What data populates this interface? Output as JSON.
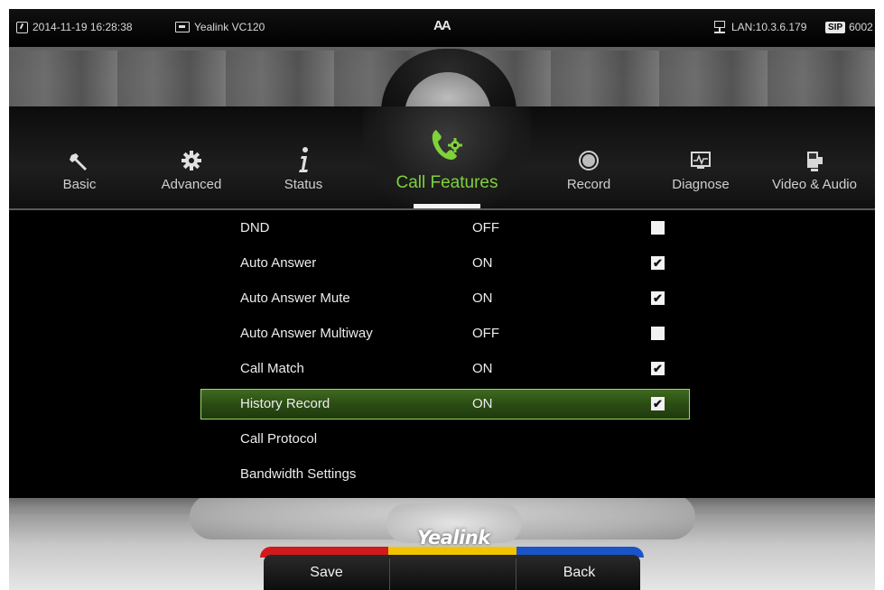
{
  "status_bar": {
    "datetime": "2014-11-19 16:28:38",
    "device_model": "Yealink VC120",
    "center_label": "AA",
    "lan": "LAN:10.3.6.179",
    "sip_badge": "SIP",
    "sip_account": "6002"
  },
  "tabs": [
    {
      "label": "Basic",
      "icon": "wrench-icon"
    },
    {
      "label": "Advanced",
      "icon": "gear-icon"
    },
    {
      "label": "Status",
      "icon": "info-icon"
    },
    {
      "label": "Call Features",
      "icon": "phone-gear-icon",
      "active": true
    },
    {
      "label": "Record",
      "icon": "record-icon"
    },
    {
      "label": "Diagnose",
      "icon": "diagnose-monitor-icon"
    },
    {
      "label": "Video & Audio",
      "icon": "video-audio-icon"
    }
  ],
  "settings": [
    {
      "name": "DND",
      "value": "OFF",
      "checked": false
    },
    {
      "name": "Auto Answer",
      "value": "ON",
      "checked": true
    },
    {
      "name": "Auto Answer Mute",
      "value": "ON",
      "checked": true
    },
    {
      "name": "Auto Answer Multiway",
      "value": "OFF",
      "checked": false
    },
    {
      "name": "Call Match",
      "value": "ON",
      "checked": true
    },
    {
      "name": "History Record",
      "value": "ON",
      "checked": true,
      "selected": true
    },
    {
      "name": "Call Protocol",
      "value": "",
      "checked": null
    },
    {
      "name": "Bandwidth Settings",
      "value": "",
      "checked": null
    }
  ],
  "brand": "Yealink",
  "softkeys": {
    "save": "Save",
    "middle": "",
    "back": "Back"
  },
  "colors": {
    "accent_green": "#7fd23a",
    "softkey_red": "#d2191b",
    "softkey_yellow": "#f2c300",
    "softkey_blue": "#1a54c8"
  },
  "check_mark": "✔"
}
